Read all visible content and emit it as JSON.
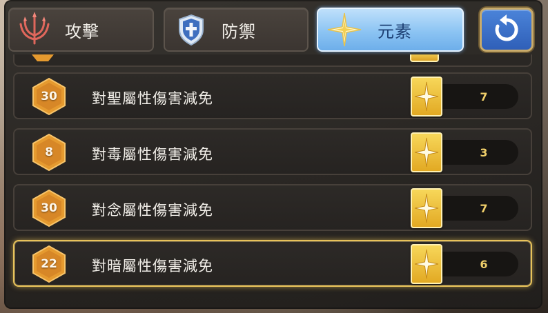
{
  "tabs": [
    {
      "key": "attack",
      "label": "攻擊",
      "icon": "trident-icon",
      "active": false
    },
    {
      "key": "defense",
      "label": "防禦",
      "icon": "shield-cross-icon",
      "active": false
    },
    {
      "key": "element",
      "label": "元素",
      "icon": "star-icon",
      "active": true
    }
  ],
  "refresh": {
    "icon": "refresh-icon"
  },
  "rows": [
    {
      "level": "30",
      "label": "對聖屬性傷害減免",
      "value": "7",
      "selected": false
    },
    {
      "level": "8",
      "label": "對毒屬性傷害減免",
      "value": "3",
      "selected": false
    },
    {
      "level": "30",
      "label": "對念屬性傷害減免",
      "value": "7",
      "selected": false
    },
    {
      "level": "22",
      "label": "對暗屬性傷害減免",
      "value": "6",
      "selected": true
    }
  ],
  "colors": {
    "active_tab": "#8cc4f3",
    "hex_badge": "#e59a2f",
    "value_text": "#f0cf6a",
    "selected_border": "#e8c35a"
  }
}
